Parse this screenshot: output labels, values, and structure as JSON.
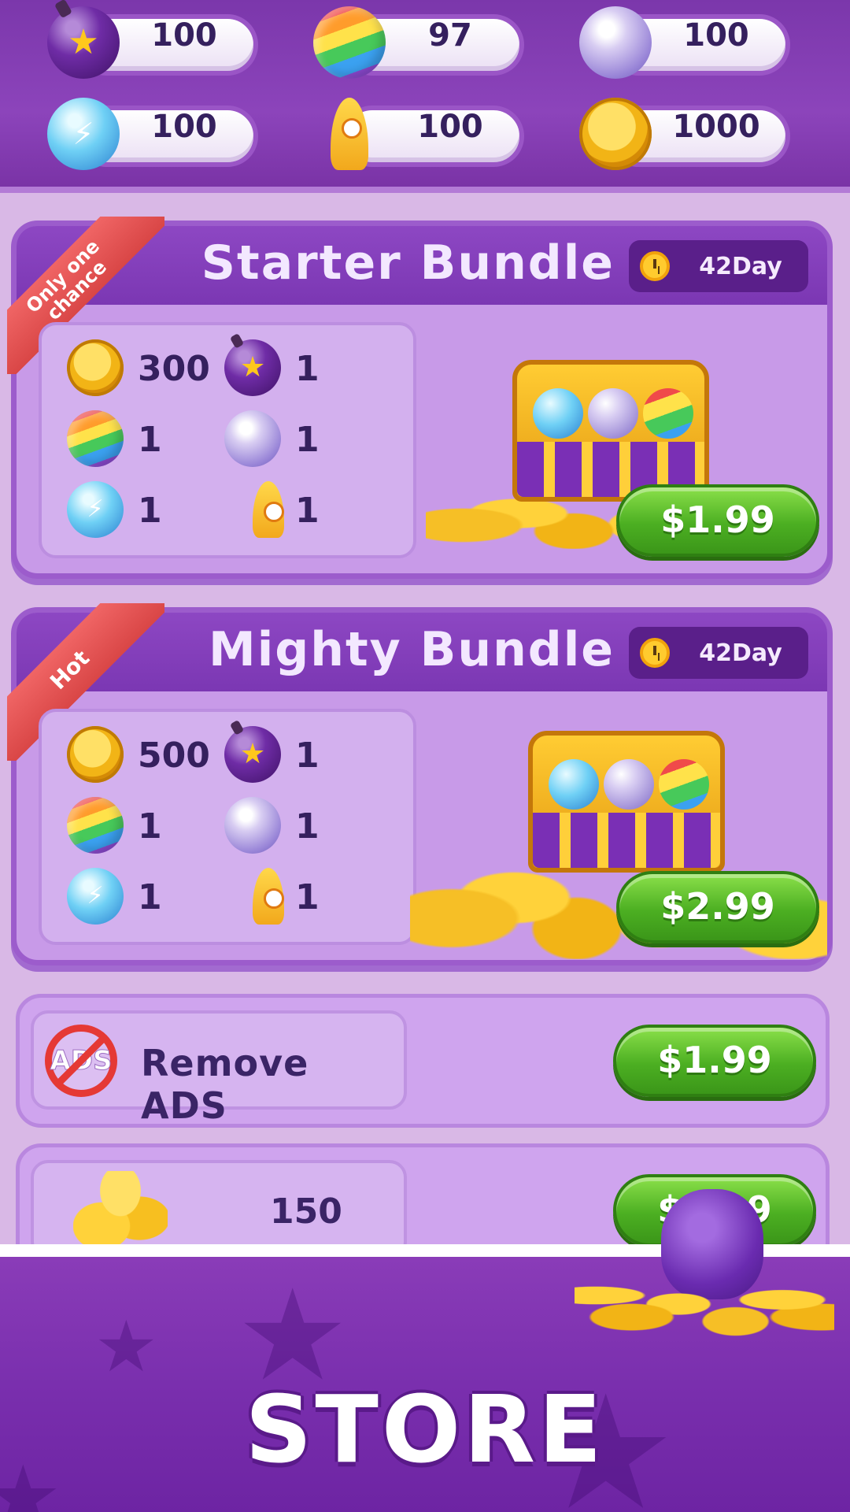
{
  "resources": [
    {
      "icon": "bomb-icon",
      "value": "100"
    },
    {
      "icon": "rainbow-ball-icon",
      "value": "97"
    },
    {
      "icon": "pearl-ball-icon",
      "value": "100"
    },
    {
      "icon": "lightning-ball-icon",
      "value": "100"
    },
    {
      "icon": "rocket-icon",
      "value": "100"
    },
    {
      "icon": "coin-icon",
      "value": "1000"
    }
  ],
  "bundles": [
    {
      "ribbon": "Only one chance",
      "title": "Starter Bundle",
      "timer": "42Day",
      "items": [
        {
          "icon": "coin-icon",
          "qty": "300"
        },
        {
          "icon": "bomb-icon",
          "qty": "1"
        },
        {
          "icon": "rainbow-ball-icon",
          "qty": "1"
        },
        {
          "icon": "pearl-ball-icon",
          "qty": "1"
        },
        {
          "icon": "lightning-ball-icon",
          "qty": "1"
        },
        {
          "icon": "rocket-icon",
          "qty": "1"
        }
      ],
      "price": "$1.99"
    },
    {
      "ribbon": "Hot",
      "title": "Mighty Bundle",
      "timer": "42Day",
      "items": [
        {
          "icon": "coin-icon",
          "qty": "500"
        },
        {
          "icon": "bomb-icon",
          "qty": "1"
        },
        {
          "icon": "rainbow-ball-icon",
          "qty": "1"
        },
        {
          "icon": "pearl-ball-icon",
          "qty": "1"
        },
        {
          "icon": "lightning-ball-icon",
          "qty": "1"
        },
        {
          "icon": "rocket-icon",
          "qty": "1"
        }
      ],
      "price": "$2.99"
    }
  ],
  "remove_ads": {
    "icon_text": "ADS",
    "label": "Remove ADS",
    "price": "$1.99"
  },
  "coin_pack": {
    "amount": "150",
    "price": "$0.99"
  },
  "footer": {
    "title": "STORE"
  },
  "colors": {
    "accent_purple": "#7b37ab",
    "button_green": "#4caf22",
    "ribbon_red": "#d94646",
    "coin_gold": "#f2b416"
  }
}
